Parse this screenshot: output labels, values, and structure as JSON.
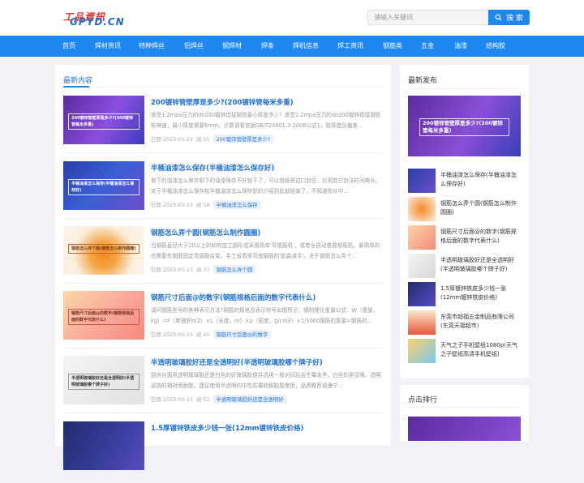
{
  "header": {
    "logo_line1": "工品資訊",
    "logo_line2": "GPYD.CN",
    "search_placeholder": "请输入关键词",
    "search_button": "搜 索"
  },
  "nav": [
    "首页",
    "焊材资讯",
    "特种焊丝",
    "铝焊丝",
    "钢焊材",
    "焊条",
    "焊机信息",
    "焊工资讯",
    "钢筋类",
    "五金",
    "油漆",
    "结构胶"
  ],
  "main": {
    "heading": "最新内容",
    "articles": [
      {
        "title": "200镀锌管壁厚是多少?(200镀锌管每米多重)",
        "excerpt": "承受1.2mpa压力的dn200镀锌焊接钢管最小厚度多少？承受1.2mpa压力的dn200镀锌焊接钢管轮神速，最小厚度需要6mm。计算请看依据GB/T20801.3-2006公式1，取厚度负偏差...",
        "date": "日期 2023-05-23",
        "views": "阅 55",
        "tag": "200镀锌管壁厚是多少?",
        "thumb_caption": "200镀锌管壁厚是多少?(200镀锌管每米多重)"
      },
      {
        "title": "半桶油漆怎么保存(半桶油漆怎么保存好)",
        "excerpt": "剩下的油漆怎么保存剩下的油漆保存不好就干了，可以用纸将边口封住，比用其它封法时间略长。关于半桶油漆怎么保存和半桶油漆怎么保存好的介绍到此就结束了，不知道你从中...",
        "date": "日期 2023-05-23",
        "views": "阅 58",
        "tag": "半桶油漆怎么保存",
        "thumb_caption": "半桶油漆怎么保存(半桶油漆怎么保存好)"
      },
      {
        "title": "钢筋怎么弄个圆(钢筋怎么制作圆圈)",
        "excerpt": "当钢筋直径大于20以上的如何加工圆形或采用简单'弯钢筋机'，或者全自动卷曲钢筋机。最简单的也需要有钢筋固定弯钢筋台架，手工省着棒弯曲钢筋的'扳森减手'。关于钢筋怎么弄个...",
        "date": "日期 2023-05-23",
        "views": "阅 37",
        "tag": "钢筋怎么弄个圆",
        "thumb_caption": "钢筋怎么弄个圆(钢筋怎么制作圆圈)"
      },
      {
        "title": "钢筋尺寸后面@的数字(钢筋规格后面的数字代表什么)",
        "excerpt": "请问钢筋型号的各种表示方法?钢筋的规格及表示符号如图所示：钢材理论重量公式：W（重量，kg）=F（断面积m2）×L（长度，m）×ρ（密度，g/cm3）×1/1000钢筋的重量=钢筋的...",
        "date": "日期 2023-05-23",
        "views": "阅 45",
        "tag": "钢筋尺寸后面@的数字",
        "thumb_caption": "钢筋尺寸后面@的数字(钢筋规格后面的数字代表什么)"
      },
      {
        "title": "半透明玻璃胶好还是全透明好(半透明玻璃胶哪个牌子好)",
        "excerpt": "厨房台面用透明玻璃胶还是白色的好玻璃胶便并选用一般对间后会生霉发黑，白色的更显眼。透明省钱的相对而耐脏。建议使用半透明的中性防霉硅酮胶胶使用，品牌推荐道康宁...",
        "date": "日期 2023-05-23",
        "views": "阅 52",
        "tag": "半透明玻璃胶好还是全透明好",
        "thumb_caption": "半透明玻璃胶好还是全透明好(半透明玻璃胶哪个牌子好)"
      },
      {
        "title": "1.5厚镀锌铁皮多少钱一张(12mm镀锌铁皮价格)",
        "excerpt": "",
        "date": "",
        "views": "",
        "tag": "",
        "thumb_caption": ""
      }
    ]
  },
  "sidebar": {
    "heading": "最新发布",
    "feature_caption": "200镀锌管壁厚是多少?(200镀锌管每米多重)",
    "items": [
      "半桶油漆怎么保存(半桶油漆怎么保存好)",
      "钢筋怎么弄个圆(钢筋怎么制作圆圈)",
      "钢筋尺寸后面@的数字(钢筋规格后面的数字代表什么)",
      "半透明玻璃胶好还是全透明好(半透明玻璃胶哪个牌子好)",
      "1.5厚镀锌铁皮多少钱一张(12mm镀锌铁皮价格)",
      "东莞市超福五金制品有限公司(东莞天福超市)",
      "天气之子手机壁纸1080p(天气之子壁纸高清手机壁纸)"
    ],
    "heading2": "点击排行"
  },
  "colors": {
    "brand_blue": "#1e87f0",
    "title_blue": "#1e6fd0",
    "logo_red": "#e03a2f"
  }
}
